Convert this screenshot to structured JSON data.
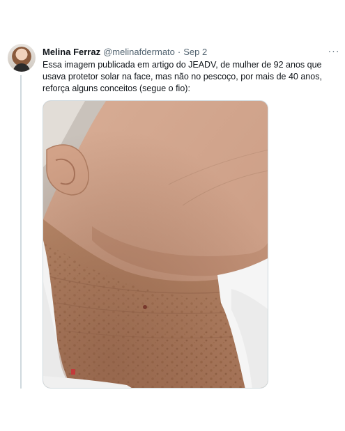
{
  "tweet": {
    "author_name": "Melina Ferraz",
    "handle": "@melinafdermato",
    "separator": "·",
    "date": "Sep 2",
    "more_glyph": "···",
    "text_lines": [
      "Essa imagem publicada em artigo do JEADV, de mulher de 92 anos que",
      "usava protetor solar na face, mas não no pescoço, por mais de 40 anos,",
      "reforça alguns conceitos (segue o fio):"
    ]
  },
  "icons": {
    "avatar": "user-avatar",
    "more": "more-options-icon"
  },
  "colors": {
    "text_primary": "#0f1419",
    "text_secondary": "#536471",
    "thread_line": "#cfd9de"
  }
}
